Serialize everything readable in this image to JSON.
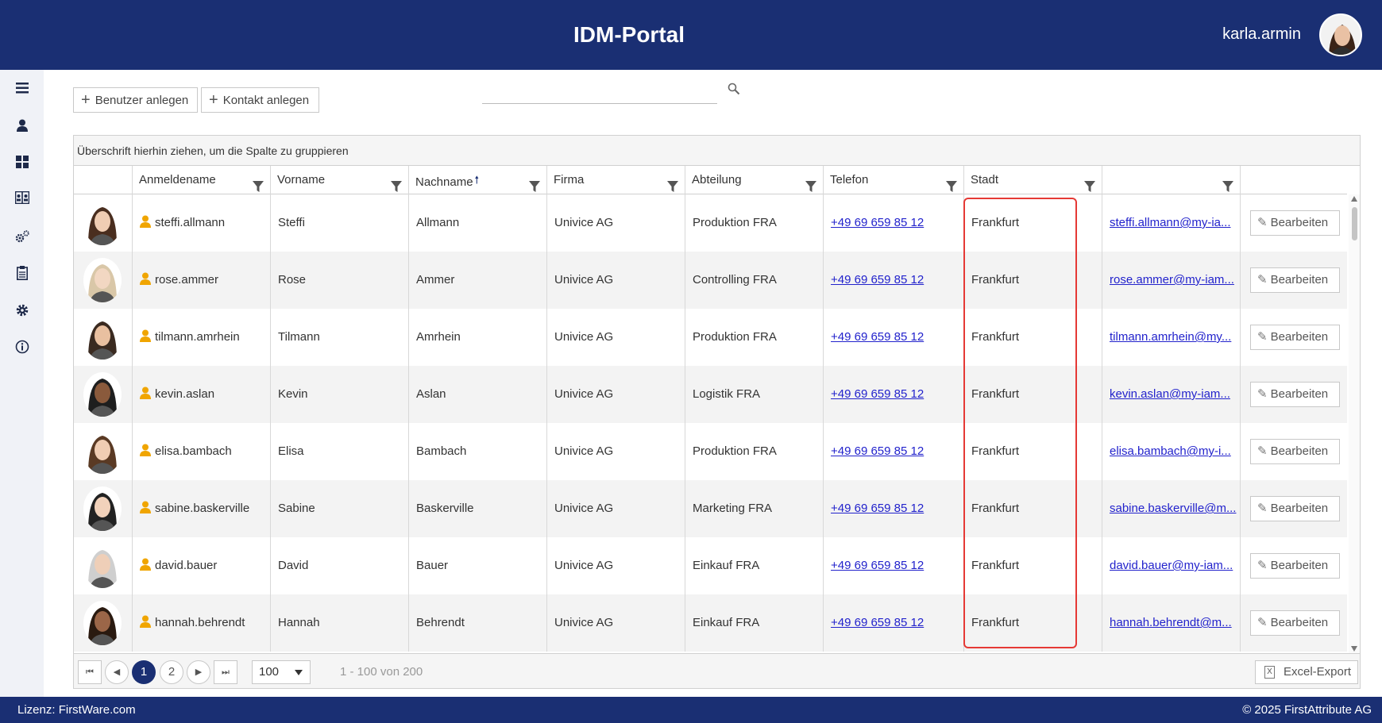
{
  "header": {
    "title": "IDM-Portal",
    "username": "karla.armin"
  },
  "sidebar": {
    "items": [
      "menu-icon",
      "user-icon",
      "dashboard-icon",
      "contacts-icon",
      "gears-icon",
      "clipboard-icon",
      "settings-icon",
      "info-icon"
    ]
  },
  "toolbar": {
    "create_user": "Benutzer anlegen",
    "create_contact": "Kontakt anlegen",
    "search_value": ""
  },
  "grid": {
    "group_hint": "Überschrift hierhin ziehen, um die Spalte zu gruppieren",
    "columns": [
      "",
      "Anmeldename",
      "Vorname",
      "Nachname",
      "Firma",
      "Abteilung",
      "Telefon",
      "Stadt",
      "",
      ""
    ],
    "sorted_column": "Nachname",
    "sort_direction": "ascending",
    "edit_label": "Bearbeiten",
    "rows": [
      {
        "login": "steffi.allmann",
        "first": "Steffi",
        "last": "Allmann",
        "company": "Univice AG",
        "dept": "Produktion FRA",
        "phone": "+49 69 659 85 12",
        "city": "Frankfurt",
        "email": "steffi.allmann@my-ia..."
      },
      {
        "login": "rose.ammer",
        "first": "Rose",
        "last": "Ammer",
        "company": "Univice AG",
        "dept": "Controlling FRA",
        "phone": "+49 69 659 85 12",
        "city": "Frankfurt",
        "email": "rose.ammer@my-iam..."
      },
      {
        "login": "tilmann.amrhein",
        "first": "Tilmann",
        "last": "Amrhein",
        "company": "Univice AG",
        "dept": "Produktion FRA",
        "phone": "+49 69 659 85 12",
        "city": "Frankfurt",
        "email": "tilmann.amrhein@my..."
      },
      {
        "login": "kevin.aslan",
        "first": "Kevin",
        "last": "Aslan",
        "company": "Univice AG",
        "dept": "Logistik FRA",
        "phone": "+49 69 659 85 12",
        "city": "Frankfurt",
        "email": "kevin.aslan@my-iam..."
      },
      {
        "login": "elisa.bambach",
        "first": "Elisa",
        "last": "Bambach",
        "company": "Univice AG",
        "dept": "Produktion FRA",
        "phone": "+49 69 659 85 12",
        "city": "Frankfurt",
        "email": "elisa.bambach@my-i..."
      },
      {
        "login": "sabine.baskerville",
        "first": "Sabine",
        "last": "Baskerville",
        "company": "Univice AG",
        "dept": "Marketing FRA",
        "phone": "+49 69 659 85 12",
        "city": "Frankfurt",
        "email": "sabine.baskerville@m..."
      },
      {
        "login": "david.bauer",
        "first": "David",
        "last": "Bauer",
        "company": "Univice AG",
        "dept": "Einkauf FRA",
        "phone": "+49 69 659 85 12",
        "city": "Frankfurt",
        "email": "david.bauer@my-iam..."
      },
      {
        "login": "hannah.behrendt",
        "first": "Hannah",
        "last": "Behrendt",
        "company": "Univice AG",
        "dept": "Einkauf FRA",
        "phone": "+49 69 659 85 12",
        "city": "Frankfurt",
        "email": "hannah.behrendt@m..."
      }
    ]
  },
  "pager": {
    "first": "⏮",
    "prev": "◀",
    "pages": [
      "1",
      "2"
    ],
    "current_page": "1",
    "next": "▶",
    "last": "⏭",
    "page_size": "100",
    "info": "1 - 100 von 200",
    "export_label": "Excel-Export"
  },
  "footer": {
    "license": "Lizenz: FirstWare.com",
    "copyright": "© 2025 FirstAttribute AG"
  },
  "colors": {
    "brand": "#1a2f73",
    "highlight": "#e53935",
    "user_icon": "#f0a500",
    "link": "#2222cc"
  }
}
